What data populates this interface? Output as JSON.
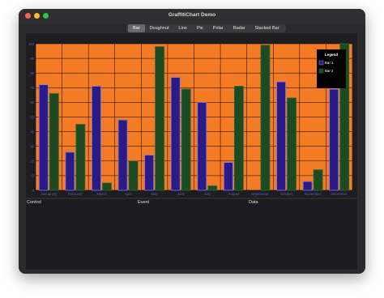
{
  "window": {
    "title": "GraffitiChart Demo"
  },
  "tabs": [
    {
      "label": "Bar",
      "active": true
    },
    {
      "label": "Doughnut",
      "active": false
    },
    {
      "label": "Line",
      "active": false
    },
    {
      "label": "Pie",
      "active": false
    },
    {
      "label": "Polar",
      "active": false
    },
    {
      "label": "Radar",
      "active": false
    },
    {
      "label": "Stacked Bar",
      "active": false
    }
  ],
  "colors": {
    "plot_background": "#f57a24",
    "bar1_fill": "#2a1a86",
    "bar1_border": "#7d7ae8",
    "bar2_fill": "#1c4a22",
    "bar2_border": "#2f6a35",
    "grid": "#000000",
    "tick_label": "#4a5fd0"
  },
  "chart_data": {
    "type": "bar",
    "categories": [
      "Januaryyy",
      "February",
      "March",
      "April",
      "May",
      "June",
      "July",
      "August",
      "September",
      "October",
      "November",
      "December"
    ],
    "series": [
      {
        "name": "Bar 1",
        "values": [
          72,
          26,
          71,
          48,
          24,
          77,
          60,
          19,
          0,
          74,
          6,
          69
        ]
      },
      {
        "name": "Bar 2",
        "values": [
          66,
          45,
          5,
          20,
          98,
          69,
          3,
          71,
          99,
          63,
          14,
          100
        ]
      }
    ],
    "ylim": [
      0,
      100
    ],
    "yticks": [
      "0",
      "10",
      "20",
      "30",
      "40",
      "50",
      "60",
      "70",
      "80",
      "90",
      "100"
    ],
    "grid": true,
    "legend": {
      "title": "Legend",
      "placement": "top-right"
    }
  },
  "bottom": {
    "columns": [
      "Control",
      "Event",
      "Data"
    ]
  }
}
